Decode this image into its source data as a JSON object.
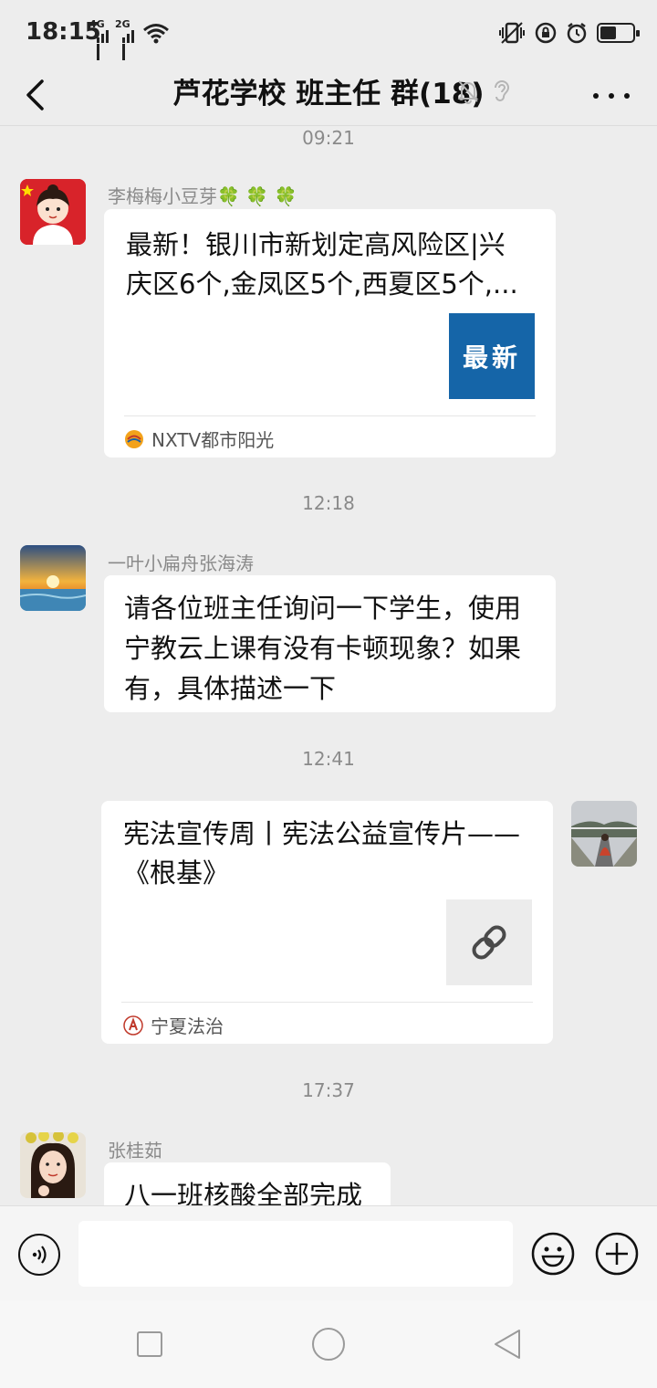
{
  "status_bar": {
    "time": "18:15",
    "signal_1_label": "4G",
    "signal_2_label": "2G",
    "battery_level": 0.45
  },
  "header": {
    "title": "芦花学校  班主任  群(18)",
    "icons": [
      "back-arrow-icon",
      "mute-bell-icon",
      "ear-icon",
      "more-dots-icon"
    ]
  },
  "messages": [
    {
      "time": "09:21",
      "sender": "李梅梅小豆芽🍀 🍀 🍀",
      "type": "link_card",
      "title_line1": "最新！银川市新划定高风险区|兴",
      "title_line2": "庆区6个,金凤区5个,西夏区5个,...",
      "thumb_text": "最新",
      "thumb_color": "#1565a8",
      "source": "NXTV都市阳光"
    },
    {
      "time": "12:18",
      "sender": "一叶小扁舟张海涛",
      "type": "text",
      "line1": "请各位班主任询问一下学生，使用",
      "line2": "宁教云上课有没有卡顿现象？如果",
      "line3": "有，具体描述一下"
    },
    {
      "time": "12:41",
      "sender": "",
      "type": "link_card_self",
      "title_line1": "宪法宣传周丨宪法公益宣传片——",
      "title_line2": "《根基》",
      "thumb_icon": "link-icon",
      "source": "宁夏法治"
    },
    {
      "time": "17:37",
      "sender": "张桂茹",
      "type": "text",
      "line1": "八一班核酸全部完成"
    }
  ],
  "input_bar": {
    "placeholder": "",
    "icons": [
      "voice-icon",
      "emoji-icon",
      "plus-icon"
    ]
  },
  "colors": {
    "background": "#ededed",
    "bubble": "#ffffff",
    "timestamp": "#8a8a8a"
  }
}
